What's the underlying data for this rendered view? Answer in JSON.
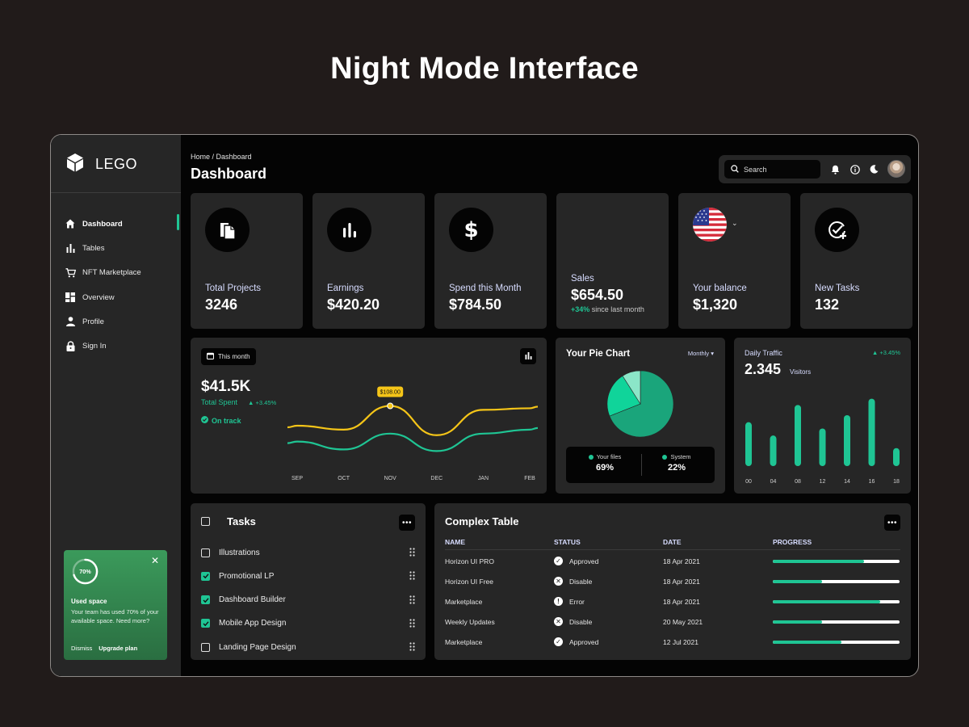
{
  "heading": "Night Mode Interface",
  "brand": {
    "name": "LEGO"
  },
  "sidebar": {
    "items": [
      {
        "label": "Dashboard",
        "icon": "home-icon",
        "active": true
      },
      {
        "label": "Tables",
        "icon": "bar-chart-icon"
      },
      {
        "label": "NFT Marketplace",
        "icon": "cart-icon"
      },
      {
        "label": "Overview",
        "icon": "grid-icon"
      },
      {
        "label": "Profile",
        "icon": "person-icon"
      },
      {
        "label": "Sign In",
        "icon": "lock-icon"
      }
    ],
    "promo": {
      "percent_label": "70%",
      "percent": 70,
      "title": "Used space",
      "text": "Your team has used 70% of your available space. Need more?",
      "dismiss": "Dismiss",
      "upgrade": "Upgrade plan"
    }
  },
  "header": {
    "breadcrumb": "Home / Dashboard",
    "title": "Dashboard",
    "search_placeholder": "Search"
  },
  "stats": [
    {
      "label": "Total Projects",
      "value": "3246",
      "icon": "documents-icon"
    },
    {
      "label": "Earnings",
      "value": "$420.20",
      "icon": "bar-chart-icon"
    },
    {
      "label": "Spend this Month",
      "value": "$784.50",
      "icon": "dollar-icon"
    },
    {
      "label": "Sales",
      "value": "$654.50",
      "change": "+34%",
      "change_text": "since last month"
    },
    {
      "label": "Your balance",
      "value": "$1,320",
      "icon": "us-flag-icon"
    },
    {
      "label": "New Tasks",
      "value": "132",
      "icon": "check-add-icon"
    }
  ],
  "spent": {
    "period": "This month",
    "value": "$41.5K",
    "label": "Total Spent",
    "change": "+3.45%",
    "status": "On track",
    "tooltip": "$108.00"
  },
  "pie": {
    "title": "Your Pie Chart",
    "period": "Monthly",
    "legend": [
      {
        "name": "Your files",
        "value": "69%",
        "color": "#1fc594"
      },
      {
        "name": "System",
        "value": "22%",
        "color": "#1fc594"
      }
    ]
  },
  "traffic": {
    "title": "Daily Traffic",
    "change": "+3.45%",
    "value": "2.345",
    "unit": "Visitors"
  },
  "tasks": {
    "title": "Tasks",
    "items": [
      {
        "label": "Illustrations",
        "checked": false
      },
      {
        "label": "Promotional LP",
        "checked": true
      },
      {
        "label": "Dashboard Builder",
        "checked": true
      },
      {
        "label": "Mobile App Design",
        "checked": true
      },
      {
        "label": "Landing Page Design",
        "checked": false
      }
    ]
  },
  "table": {
    "title": "Complex Table",
    "columns": [
      "NAME",
      "STATUS",
      "DATE",
      "PROGRESS"
    ],
    "rows": [
      {
        "name": "Horizon UI PRO",
        "status": "Approved",
        "date": "18 Apr 2021",
        "progress": 72
      },
      {
        "name": "Horizon UI Free",
        "status": "Disable",
        "date": "18 Apr 2021",
        "progress": 39
      },
      {
        "name": "Marketplace",
        "status": "Error",
        "date": "18 Apr 2021",
        "progress": 85
      },
      {
        "name": "Weekly Updates",
        "status": "Disable",
        "date": "20 May 2021",
        "progress": 39
      },
      {
        "name": "Marketplace",
        "status": "Approved",
        "date": "12 Jul 2021",
        "progress": 54
      }
    ]
  },
  "chart_data": [
    {
      "type": "line",
      "categories": [
        "SEP",
        "OCT",
        "NOV",
        "DEC",
        "JAN",
        "FEB"
      ],
      "series": [
        {
          "values": [
            50,
            45,
            75,
            38,
            70,
            72
          ],
          "color": "#f5c518"
        },
        {
          "values": [
            30,
            20,
            40,
            18,
            40,
            45
          ],
          "color": "#1fc594"
        }
      ],
      "ylim": [
        0,
        100
      ],
      "grid": false
    },
    {
      "type": "pie",
      "values": [
        69,
        22,
        9
      ],
      "colors": [
        "#1aa57b",
        "#10d49a",
        "#8be6c8"
      ]
    },
    {
      "type": "bar",
      "categories": [
        "00",
        "04",
        "08",
        "12",
        "14",
        "16",
        "18"
      ],
      "values": [
        56,
        39,
        78,
        48,
        65,
        86,
        23
      ],
      "ylim": [
        0,
        100
      ],
      "color": "#1fc594"
    }
  ]
}
